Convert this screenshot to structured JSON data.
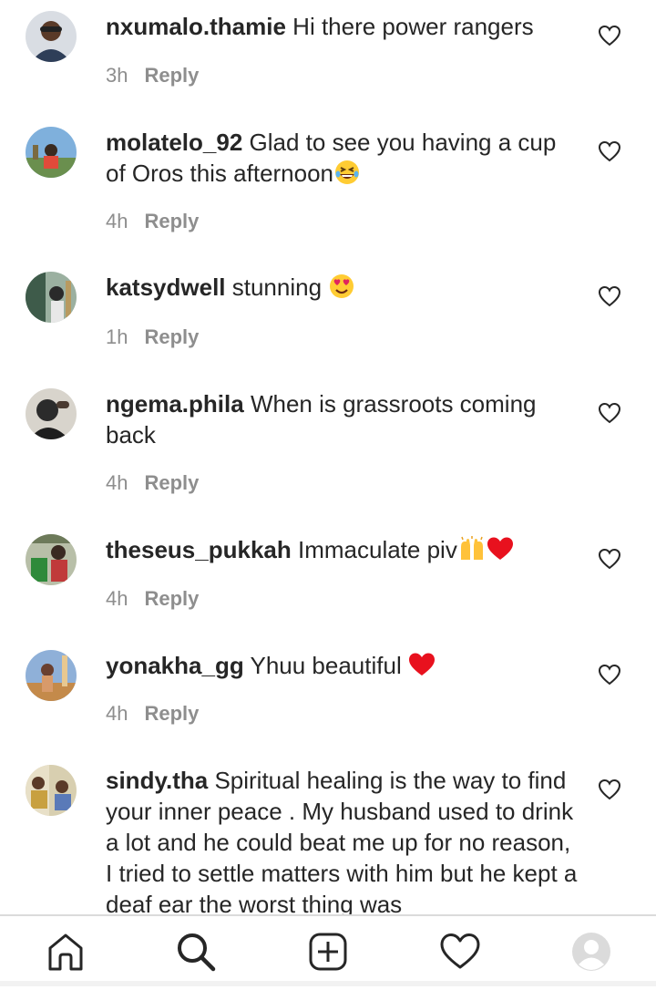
{
  "comments": [
    {
      "username": "nxumalo.thamie",
      "text": "Hi there power rangers",
      "emoji": "",
      "time": "3h",
      "reply": "Reply",
      "avatar_color": "#3a4a5e"
    },
    {
      "username": "molatelo_92",
      "text": "Glad to see you having a cup of Oros this afternoon",
      "emoji": "laughing-face",
      "time": "4h",
      "reply": "Reply",
      "avatar_color": "#5a8ab8"
    },
    {
      "username": "katsydwell",
      "text": "stunning",
      "emoji": "heart-eyes-face",
      "time": "1h",
      "reply": "Reply",
      "avatar_color": "#3e5b4a"
    },
    {
      "username": "ngema.phila",
      "text": "When is grassroots coming back",
      "emoji": "",
      "time": "4h",
      "reply": "Reply",
      "avatar_color": "#2b2b2b"
    },
    {
      "username": "theseus_pukkah",
      "text": "Immaculate piv",
      "emoji": "raising-hands, red-heart",
      "time": "4h",
      "reply": "Reply",
      "avatar_color": "#6d7a5a"
    },
    {
      "username": "yonakha_gg",
      "text": "Yhuu beautiful",
      "emoji": "red-heart",
      "time": "4h",
      "reply": "Reply",
      "avatar_color": "#c48a4a"
    },
    {
      "username": "sindy.tha",
      "text": "Spiritual healing is the way to find your inner peace . My husband used to drink a lot and he could beat me up for no reason, I tried to settle matters with him but he kept a deaf ear the worst thing was",
      "emoji": "",
      "time": "",
      "reply": "",
      "avatar_color": "#b8a060"
    }
  ],
  "nav": {
    "items": [
      "home-icon",
      "search-icon",
      "new-post-icon",
      "activity-heart-icon",
      "profile-avatar-icon"
    ]
  },
  "colors": {
    "text": "#262626",
    "meta": "#8e8e8e",
    "heart": "#e0245e",
    "border": "#dbdbdb"
  }
}
